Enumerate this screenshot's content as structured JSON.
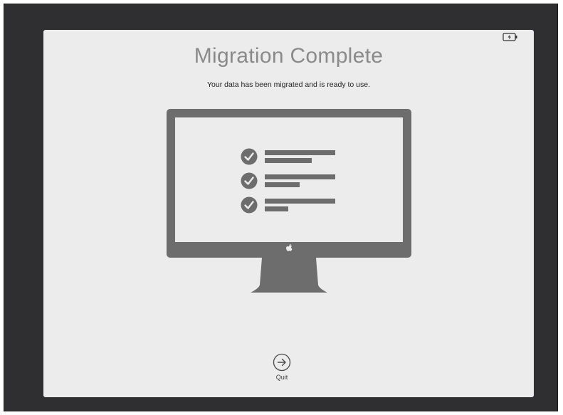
{
  "window": {
    "title": "Migration Complete",
    "subtitle": "Your data has been migrated and is ready to use."
  },
  "status_bar": {
    "battery_icon": "battery-charging-icon"
  },
  "illustration": {
    "icon": "imac-checklist-icon",
    "checklist_items": 3,
    "check_icon": "checkmark-circle-icon",
    "logo_icon": "apple-logo-icon"
  },
  "actions": {
    "quit_label": "Quit",
    "quit_icon": "arrow-right-circle-icon"
  },
  "colors": {
    "background": "#2f2f31",
    "panel": "#ececec",
    "illustration": "#6d6d6d",
    "title": "#8a8a8a"
  }
}
